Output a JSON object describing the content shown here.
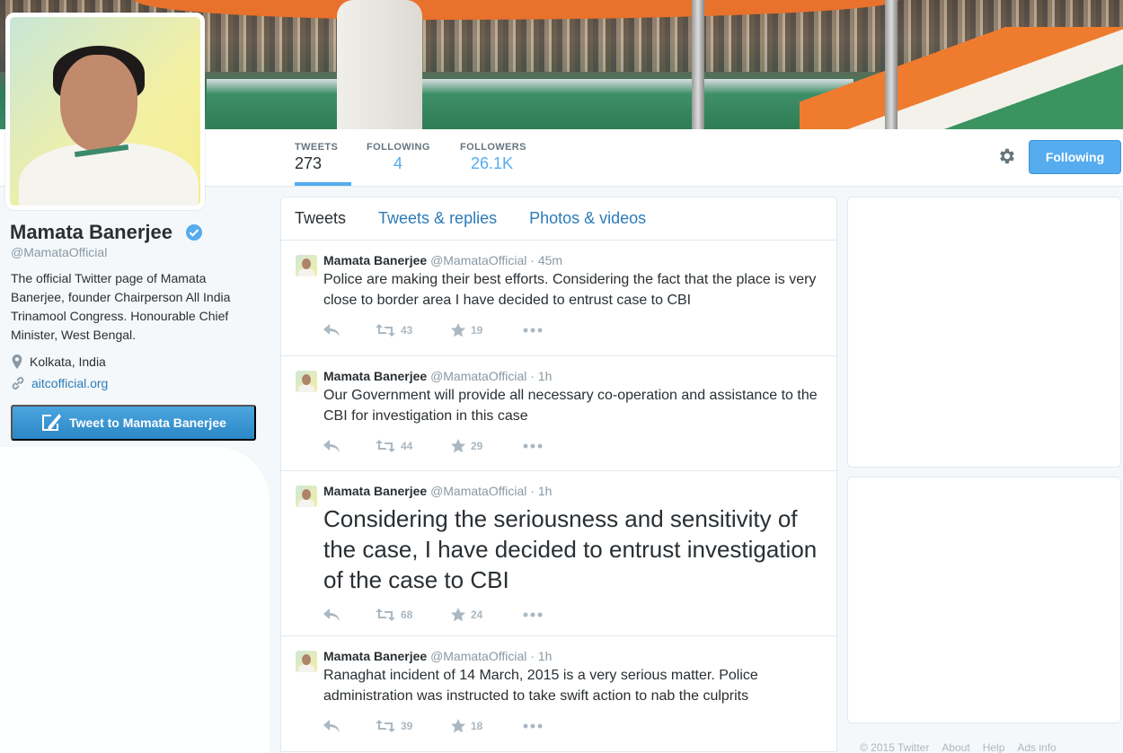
{
  "profile": {
    "name": "Mamata Banerjee",
    "handle": "@MamataOfficial",
    "bio": "The official Twitter page of Mamata Banerjee, founder Chairperson All India Trinamool Congress. Honourable Chief Minister, West Bengal.",
    "location": "Kolkata, India",
    "website": "aitcofficial.org",
    "tweet_to_label": "Tweet to Mamata Banerjee"
  },
  "stats": [
    {
      "label": "TWEETS",
      "value": "273"
    },
    {
      "label": "FOLLOWING",
      "value": "4"
    },
    {
      "label": "FOLLOWERS",
      "value": "26.1K"
    }
  ],
  "follow_button": "Following",
  "tabs": [
    "Tweets",
    "Tweets & replies",
    "Photos & videos"
  ],
  "tweets": [
    {
      "name": "Mamata Banerjee",
      "handle": "@MamataOfficial",
      "time": "· 45m",
      "text": "Police are making their best efforts. Considering the fact that the place is very close to border area I have decided to entrust case to CBI",
      "retweets": "43",
      "favorites": "19"
    },
    {
      "name": "Mamata Banerjee",
      "handle": "@MamataOfficial",
      "time": "· 1h",
      "text": "Our Government will provide all necessary co-operation and assistance to the CBI for investigation in this case",
      "retweets": "44",
      "favorites": "29"
    },
    {
      "name": "Mamata Banerjee",
      "handle": "@MamataOfficial",
      "time": "· 1h",
      "text": "Considering the seriousness and sensitivity of the case, I have decided to entrust investigation of the case to CBI",
      "retweets": "68",
      "favorites": "24"
    },
    {
      "name": "Mamata Banerjee",
      "handle": "@MamataOfficial",
      "time": "· 1h",
      "text": "Ranaghat incident of 14 March, 2015 is a very serious matter. Police administration was instructed to take swift action to nab the culprits",
      "retweets": "39",
      "favorites": "18"
    }
  ],
  "footer": [
    "© 2015 Twitter",
    "About",
    "Help",
    "Ads info"
  ],
  "colors": {
    "accent": "#55acee",
    "link": "#2b7bb9",
    "text": "#292f33",
    "muted": "#8899a6"
  }
}
